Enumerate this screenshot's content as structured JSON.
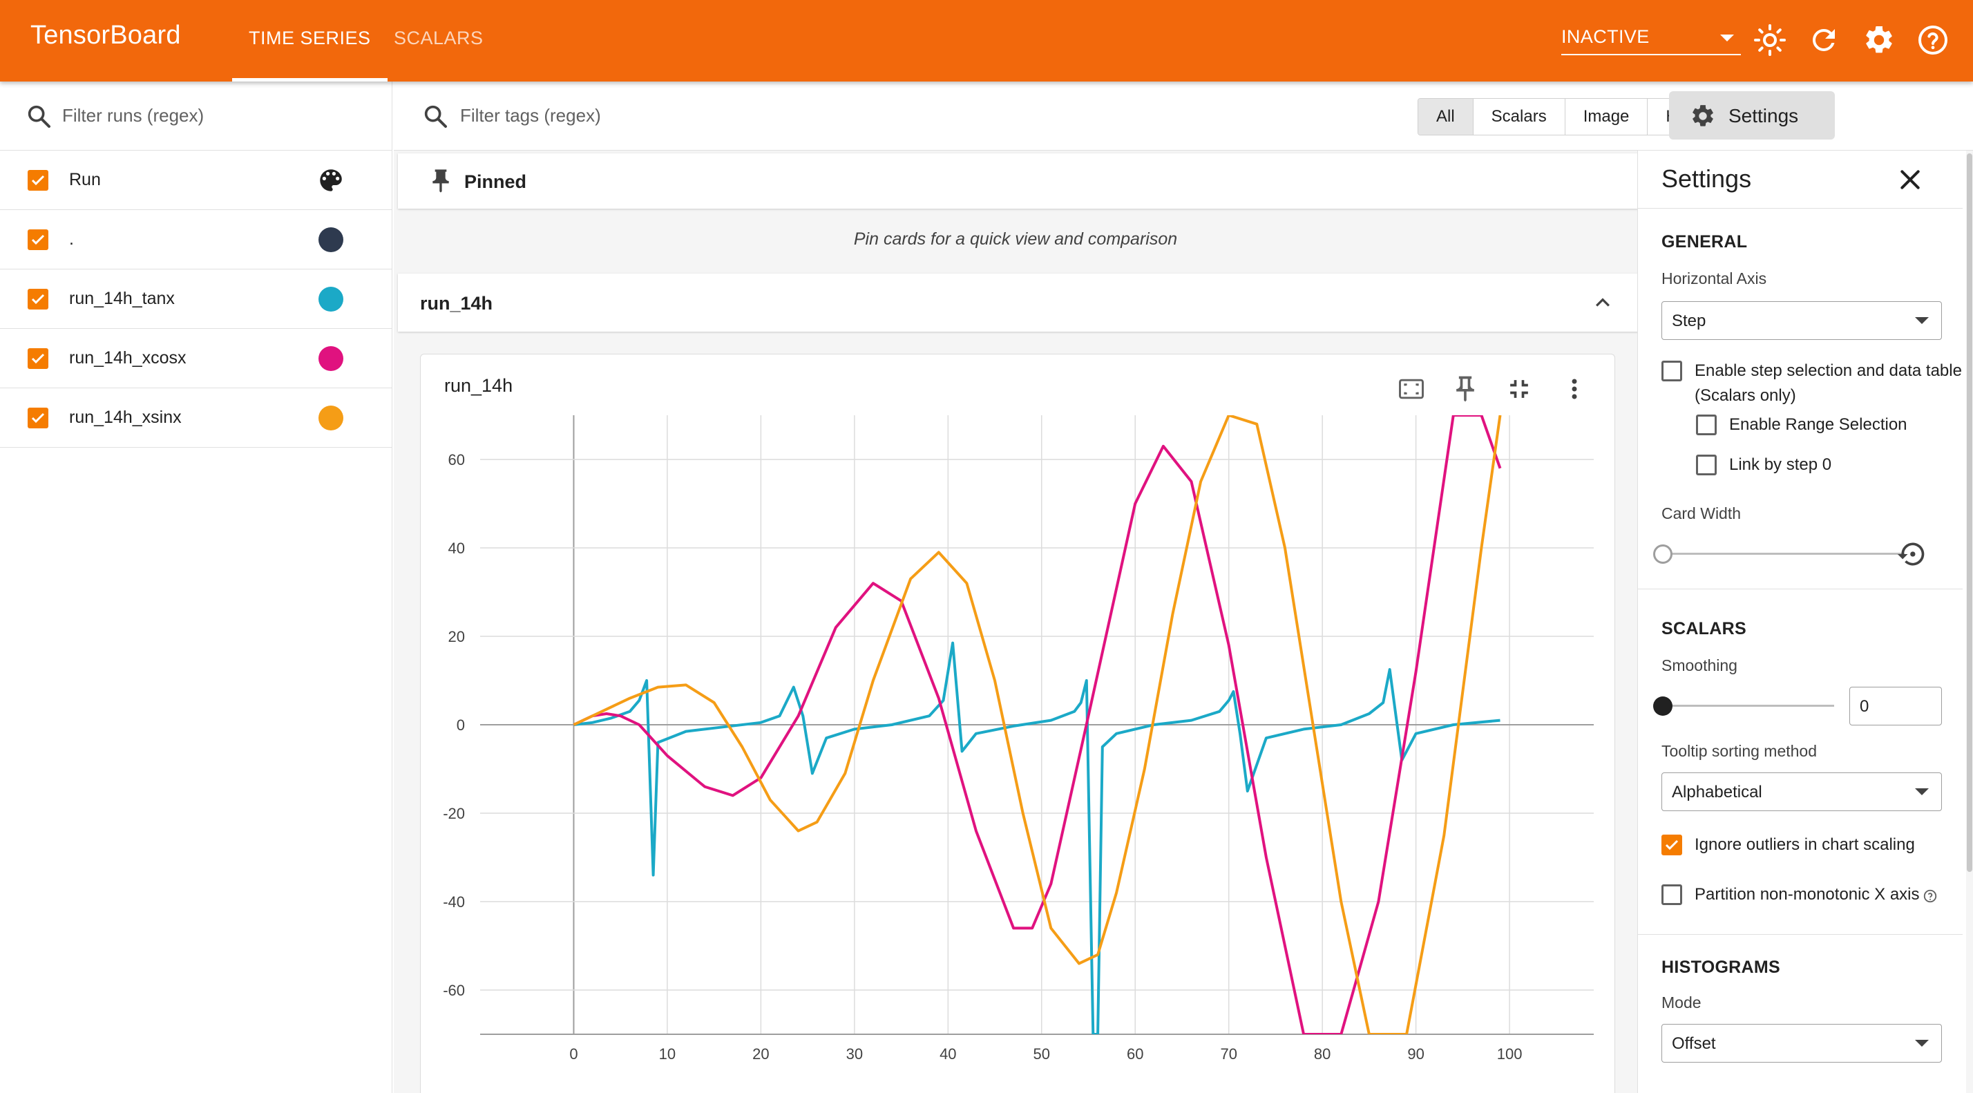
{
  "app": {
    "brand": "TensorBoard",
    "tabs": [
      {
        "label": "TIME SERIES",
        "active": true
      },
      {
        "label": "SCALARS",
        "active": false
      }
    ],
    "reload_status": "INACTIVE",
    "colors": {
      "header": "#f2680c",
      "accent": "#f57c00"
    }
  },
  "runs_panel": {
    "filter_placeholder": "Filter runs (regex)",
    "header_label": "Run",
    "runs": [
      {
        "label": ".",
        "color": "#2e3a4f",
        "checked": true
      },
      {
        "label": "run_14h_tanx",
        "color": "#1ba9c7",
        "checked": true
      },
      {
        "label": "run_14h_xcosx",
        "color": "#e0127f",
        "checked": true
      },
      {
        "label": "run_14h_xsinx",
        "color": "#f59d16",
        "checked": true
      }
    ]
  },
  "main": {
    "tag_filter_placeholder": "Filter tags (regex)",
    "type_filters": [
      "All",
      "Scalars",
      "Image",
      "Histogram"
    ],
    "active_type_filter": "All",
    "settings_button": "Settings",
    "pinned_title": "Pinned",
    "pinned_hint": "Pin cards for a quick view and comparison",
    "group_title": "run_14h",
    "card_title": "run_14h"
  },
  "chart_data": {
    "type": "line",
    "title": "run_14h",
    "xlabel": "",
    "ylabel": "",
    "xlim": [
      -10,
      109
    ],
    "ylim": [
      -70,
      70
    ],
    "x_ticks": [
      0,
      10,
      20,
      30,
      40,
      50,
      60,
      70,
      80,
      90,
      100
    ],
    "y_ticks": [
      60,
      40,
      20,
      0,
      -20,
      -40,
      -60
    ],
    "grid": true,
    "legend": "none",
    "series": [
      {
        "name": "run_14h_tanx",
        "color": "#1ba9c7",
        "x": [
          0,
          2,
          4,
          6,
          7,
          7.8,
          8.5,
          9,
          12,
          16,
          20,
          22,
          23.5,
          24.5,
          25.5,
          27,
          30,
          34,
          38,
          39.5,
          40.5,
          41.5,
          43,
          47,
          51,
          53.5,
          54.2,
          54.8,
          55.5,
          56,
          56.5,
          58,
          62,
          66,
          69,
          70,
          70.5,
          71.2,
          72,
          74,
          78,
          82,
          85,
          86.5,
          87.2,
          87.8,
          88.5,
          90,
          94,
          99
        ],
        "y": [
          0,
          0.5,
          1.5,
          3,
          5.5,
          10,
          -34,
          -4,
          -1.5,
          -0.5,
          0.5,
          2,
          8.5,
          2,
          -11,
          -3,
          -1,
          0,
          2,
          5.5,
          18.5,
          -6,
          -2,
          -0.3,
          1,
          3,
          5,
          10,
          -70,
          -70,
          -5,
          -2,
          0,
          1,
          3,
          5.5,
          7.5,
          -2,
          -15,
          -3,
          -1,
          0,
          2.5,
          5,
          12.5,
          3,
          -8,
          -2,
          0,
          1
        ]
      },
      {
        "name": "run_14h_xcosx",
        "color": "#e0127f",
        "x": [
          0,
          2,
          3.5,
          5,
          7,
          10,
          14,
          17,
          20,
          24,
          28,
          32,
          35,
          39,
          43,
          47,
          49,
          51,
          55,
          60,
          63,
          66,
          70,
          74,
          78,
          82,
          86,
          90,
          94,
          97,
          99
        ],
        "y": [
          0,
          2,
          2.5,
          2,
          0,
          -7,
          -14,
          -16,
          -12,
          2,
          22,
          32,
          28,
          6,
          -24,
          -46,
          -46,
          -36,
          2,
          50,
          63,
          55,
          18,
          -30,
          -70,
          -70,
          -40,
          12,
          70,
          70,
          58
        ]
      },
      {
        "name": "run_14h_xsinx",
        "color": "#f59d16",
        "x": [
          0,
          3,
          6,
          9,
          12,
          15,
          18,
          21,
          24,
          26,
          29,
          32,
          36,
          39,
          42,
          45,
          48,
          51,
          54,
          56,
          58,
          61,
          64,
          67,
          70,
          73,
          76,
          79,
          82,
          85,
          89,
          93,
          97,
          99
        ],
        "y": [
          0,
          3,
          6,
          8.5,
          9,
          5,
          -5,
          -17,
          -24,
          -22,
          -11,
          10,
          33,
          39,
          32,
          10,
          -20,
          -46,
          -54,
          -52,
          -38,
          -10,
          25,
          55,
          70,
          68,
          40,
          0,
          -40,
          -70,
          -70,
          -25,
          40,
          70
        ]
      }
    ]
  },
  "settings": {
    "title": "Settings",
    "general": {
      "title": "GENERAL",
      "horizontal_axis_label": "Horizontal Axis",
      "horizontal_axis_value": "Step",
      "step_selection_line1": "Enable step selection and data table",
      "step_selection_line2": "(Scalars only)",
      "range_selection": "Enable Range Selection",
      "link_by_step": "Link by step 0",
      "card_width_label": "Card Width"
    },
    "scalars": {
      "title": "SCALARS",
      "smoothing_label": "Smoothing",
      "smoothing_value": "0",
      "tooltip_label": "Tooltip sorting method",
      "tooltip_value": "Alphabetical",
      "ignore_outliers": "Ignore outliers in chart scaling",
      "ignore_outliers_checked": true,
      "partition": "Partition non-monotonic X axis"
    },
    "histograms": {
      "title": "HISTOGRAMS",
      "mode_label": "Mode",
      "mode_value": "Offset"
    }
  }
}
